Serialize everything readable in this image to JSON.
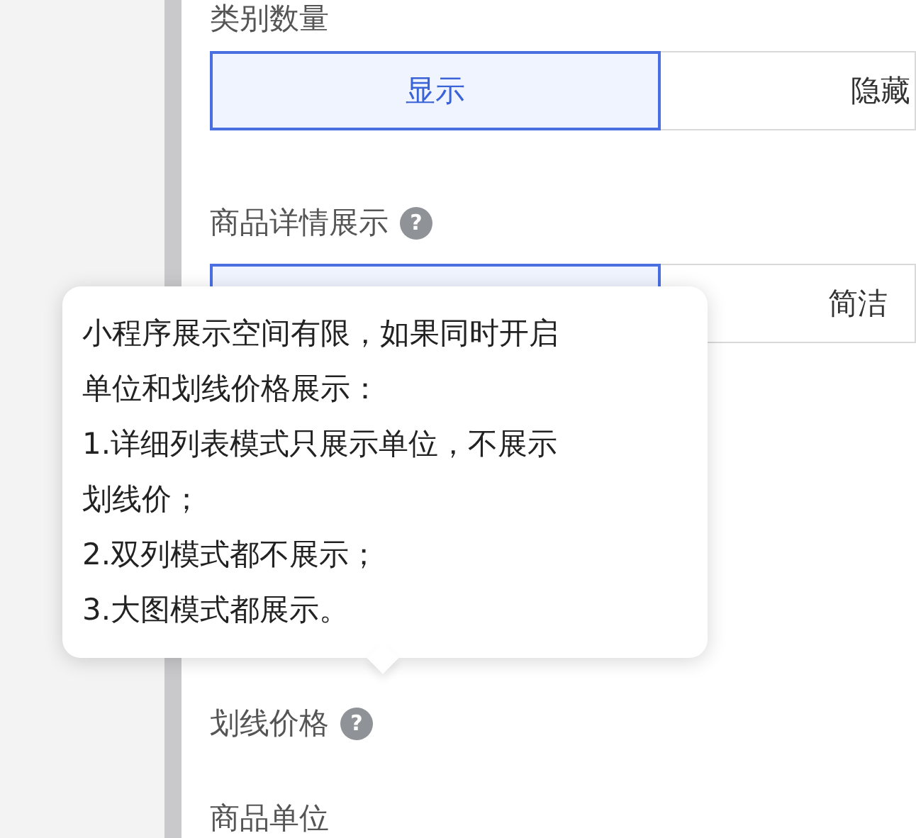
{
  "sections": [
    {
      "label": "类别数量",
      "options": [
        {
          "label": "显示",
          "selected": true
        },
        {
          "label": "隐藏",
          "selected": false
        }
      ]
    },
    {
      "label": "商品详情展示",
      "help": "?",
      "options": [
        {
          "selected": true
        },
        {
          "label": "简洁",
          "selected": false
        }
      ]
    },
    {
      "label": "划线价格",
      "help": "?"
    },
    {
      "label": "商品单位"
    }
  ],
  "tooltip": {
    "lines": [
      "小程序展示空间有限，如果同时开启",
      "单位和划线价格展示：",
      "1.详细列表模式只展示单位，不展示",
      "划线价；",
      "2.双列模式都不展示；",
      "3.大图模式都展示。"
    ]
  }
}
